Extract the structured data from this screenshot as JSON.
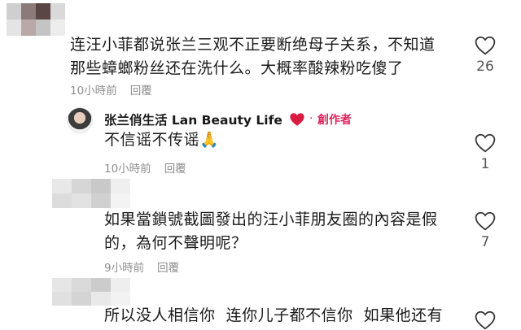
{
  "comments": [
    {
      "text": "连汪小菲都说张兰三观不正要断绝母子关系，不知道\n那些蟑螂粉丝还在洗什么。大概率酸辣粉吃傻了",
      "time": "10小時前",
      "reply": "回覆",
      "likes": "26"
    },
    {
      "author": "张兰俏生活 Lan Beauty Life",
      "creator_badge": "創作者",
      "text": "不信谣不传谣🙏",
      "time": "10小時前",
      "reply": "回覆",
      "likes": "1"
    },
    {
      "text": "如果當鎖號截圖發出的汪小菲朋友圈的內容是假\n的，為何不聲明呢？",
      "time": "9小時前",
      "reply": "回覆",
      "likes": "7"
    },
    {
      "text": "所以没人相信你  连你儿子都不信你  如果他还有"
    }
  ],
  "icons": {
    "like": "heart-outline-icon",
    "creator_heart": "red-heart-icon"
  },
  "colors": {
    "creator": "#e0245e",
    "meta": "#8e8e8e"
  }
}
